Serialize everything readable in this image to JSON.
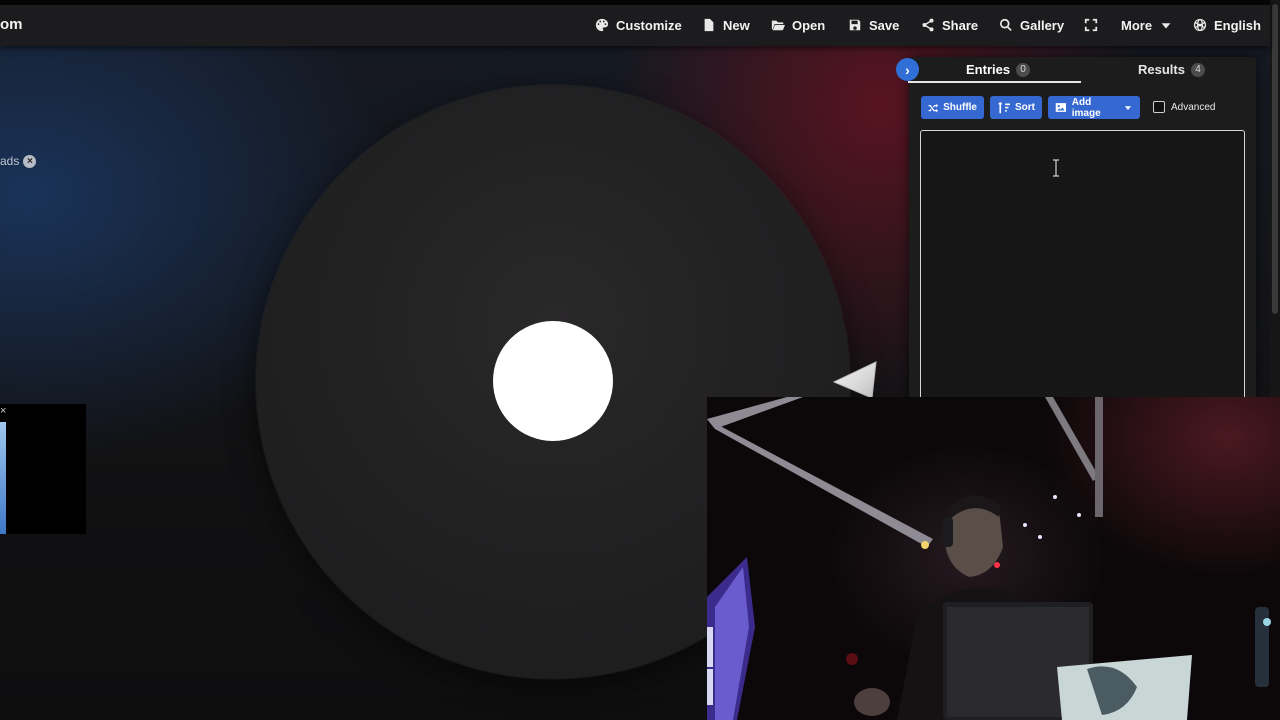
{
  "brand": {
    "text": "om"
  },
  "nav": [
    {
      "label": "Customize",
      "icon": "palette-icon"
    },
    {
      "label": "New",
      "icon": "file-icon"
    },
    {
      "label": "Open",
      "icon": "folder-open-icon"
    },
    {
      "label": "Save",
      "icon": "save-icon"
    },
    {
      "label": "Share",
      "icon": "share-icon"
    },
    {
      "label": "Gallery",
      "icon": "search-icon"
    },
    {
      "label": "",
      "icon": "fullscreen-icon"
    },
    {
      "label": "More",
      "icon": "caret-down-icon"
    },
    {
      "label": "English",
      "icon": "globe-icon"
    }
  ],
  "chip": {
    "label": "ads"
  },
  "panel": {
    "tabs": [
      {
        "label": "Entries",
        "count": "0",
        "active": true
      },
      {
        "label": "Results",
        "count": "4",
        "active": false
      }
    ],
    "buttons": {
      "shuffle": "Shuffle",
      "sort": "Sort",
      "add_image": "Add image"
    },
    "advanced_label": "Advanced",
    "advanced_checked": false,
    "entries_value": ""
  },
  "colors": {
    "accent": "#3568d1",
    "wheel": "#232223",
    "nav_bg": "#1c1c1e",
    "panel_bg": "#1c1c1c"
  }
}
